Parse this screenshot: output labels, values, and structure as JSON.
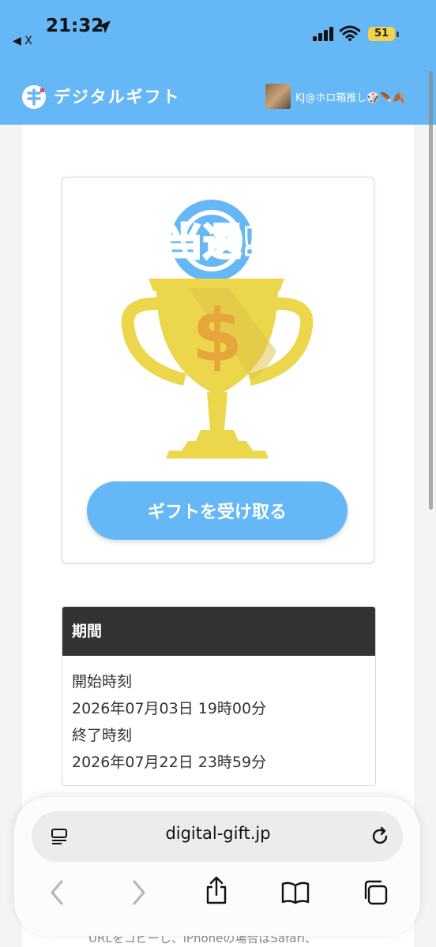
{
  "status_bar": {
    "time": "21:32",
    "back_app": "◀ X",
    "battery": "51"
  },
  "header": {
    "brand": "デジタルギフト",
    "user_name": "KJ@ホロ箱推し🎲🪶🍂"
  },
  "prize": {
    "badge_text": "当選!",
    "button_label": "ギフトを受け取る"
  },
  "period": {
    "title": "期間",
    "start_label": "開始時刻",
    "start_value": "2026年07月03日 19時00分",
    "end_label": "終了時刻",
    "end_value": "2026年07月22日 23時59分"
  },
  "below_fold": {
    "text": "URLをコピーし、iPhoneの場合はSafari、"
  },
  "browser": {
    "url": "digital-gift.jp"
  },
  "colors": {
    "accent": "#66b7f6",
    "trophy_gold": "#ecd64c",
    "dark_header": "#333333"
  }
}
